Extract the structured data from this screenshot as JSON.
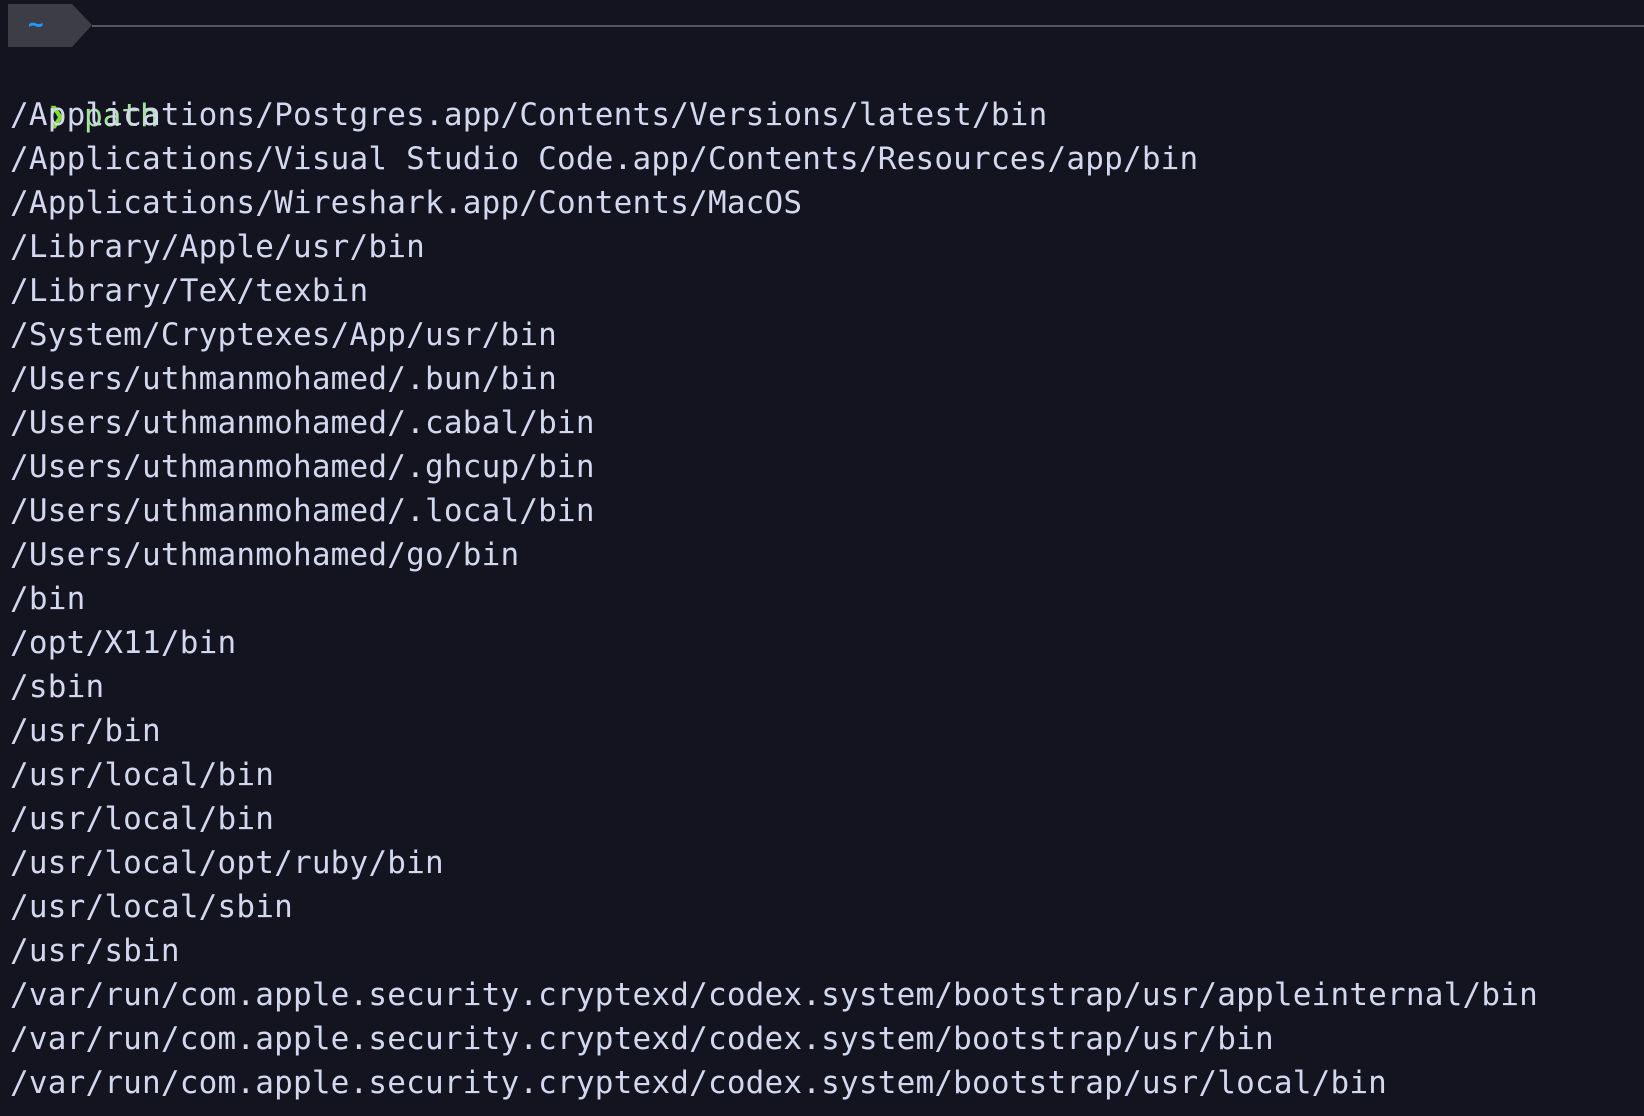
{
  "colors": {
    "background": "#13141f",
    "segment_fill": "#3c3d47",
    "segment_text": "#1e9bff",
    "divider_line": "#6b6d78",
    "prompt_char": "#7ee22d",
    "command_text": "#a6e3a1",
    "output_text": "#d4d8ef"
  },
  "prompt": {
    "directory": "~",
    "symbol": "❯",
    "command": "path"
  },
  "output_lines": [
    "/Applications/Postgres.app/Contents/Versions/latest/bin",
    "/Applications/Visual Studio Code.app/Contents/Resources/app/bin",
    "/Applications/Wireshark.app/Contents/MacOS",
    "/Library/Apple/usr/bin",
    "/Library/TeX/texbin",
    "/System/Cryptexes/App/usr/bin",
    "/Users/uthmanmohamed/.bun/bin",
    "/Users/uthmanmohamed/.cabal/bin",
    "/Users/uthmanmohamed/.ghcup/bin",
    "/Users/uthmanmohamed/.local/bin",
    "/Users/uthmanmohamed/go/bin",
    "/bin",
    "/opt/X11/bin",
    "/sbin",
    "/usr/bin",
    "/usr/local/bin",
    "/usr/local/bin",
    "/usr/local/opt/ruby/bin",
    "/usr/local/sbin",
    "/usr/sbin",
    "/var/run/com.apple.security.cryptexd/codex.system/bootstrap/usr/appleinternal/bin",
    "/var/run/com.apple.security.cryptexd/codex.system/bootstrap/usr/bin",
    "/var/run/com.apple.security.cryptexd/codex.system/bootstrap/usr/local/bin"
  ]
}
